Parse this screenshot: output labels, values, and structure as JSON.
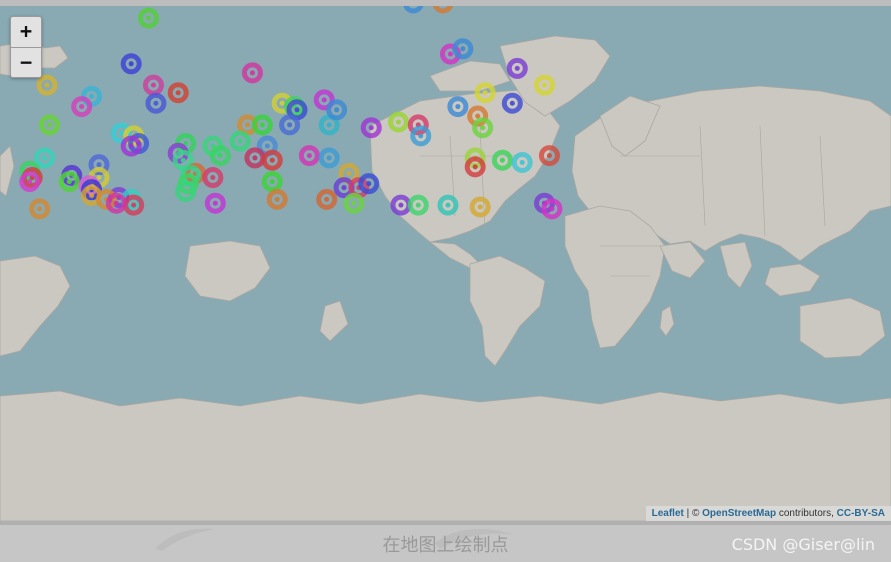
{
  "zoom": {
    "in_label": "+",
    "out_label": "−"
  },
  "attribution": {
    "leaflet": "Leaflet",
    "sep": " | © ",
    "osm": "OpenStreetMap",
    "contributors": " contributors, ",
    "license": "CC-BY-SA"
  },
  "caption": "在地图上绘制点",
  "watermark": "CSDN @Giser@lin",
  "colors": {
    "ocean": "#89a9b3",
    "land": "#cbc8c2",
    "border": "#a9a6a0"
  },
  "markers": [
    {
      "lon": -130,
      "lat": 75,
      "color": "#53d034"
    },
    {
      "lon": -137,
      "lat": 67,
      "color": "#3b3fd7"
    },
    {
      "lon": -128,
      "lat": 62,
      "color": "#d03b9c"
    },
    {
      "lon": -127,
      "lat": 57,
      "color": "#4a55d6"
    },
    {
      "lon": -118,
      "lat": 60,
      "color": "#d4402f"
    },
    {
      "lon": -153,
      "lat": 59,
      "color": "#37b4d4"
    },
    {
      "lon": -171,
      "lat": 62,
      "color": "#d4b12f"
    },
    {
      "lon": -157,
      "lat": 56,
      "color": "#d63dbb"
    },
    {
      "lon": -170,
      "lat": 50,
      "color": "#66d42f"
    },
    {
      "lon": -141,
      "lat": 47,
      "color": "#31d0d4"
    },
    {
      "lon": -136,
      "lat": 46,
      "color": "#d4d02f"
    },
    {
      "lon": -134,
      "lat": 43,
      "color": "#3b58d4"
    },
    {
      "lon": -137,
      "lat": 42,
      "color": "#a032d4"
    },
    {
      "lon": -172,
      "lat": 37,
      "color": "#32d4b9"
    },
    {
      "lon": -150,
      "lat": 34,
      "color": "#4f67d6"
    },
    {
      "lon": -161,
      "lat": 29,
      "color": "#5532d4"
    },
    {
      "lon": -162,
      "lat": 26,
      "color": "#4fd432"
    },
    {
      "lon": -150,
      "lat": 28,
      "color": "#d4cc2f"
    },
    {
      "lon": -154,
      "lat": 24,
      "color": "#d45cd4"
    },
    {
      "lon": -153,
      "lat": 22,
      "color": "#3b2fd4"
    },
    {
      "lon": -153,
      "lat": 19,
      "color": "#d4a82f"
    },
    {
      "lon": -142,
      "lat": 18,
      "color": "#7d3bd4"
    },
    {
      "lon": -147,
      "lat": 17,
      "color": "#d48a2f"
    },
    {
      "lon": -137,
      "lat": 17,
      "color": "#31d0c0"
    },
    {
      "lon": -136,
      "lat": 14,
      "color": "#d43b5a"
    },
    {
      "lon": -143,
      "lat": 15,
      "color": "#d432a4"
    },
    {
      "lon": -178,
      "lat": 31,
      "color": "#37d45e"
    },
    {
      "lon": -177,
      "lat": 28,
      "color": "#d43b3b"
    },
    {
      "lon": -178,
      "lat": 26,
      "color": "#d43bd0"
    },
    {
      "lon": -174,
      "lat": 12,
      "color": "#d4882f"
    },
    {
      "lon": -115,
      "lat": 43,
      "color": "#31d45a"
    },
    {
      "lon": -118,
      "lat": 39,
      "color": "#8b3bd4"
    },
    {
      "lon": -116,
      "lat": 36,
      "color": "#3bd48a"
    },
    {
      "lon": -104,
      "lat": 42,
      "color": "#3bd47a"
    },
    {
      "lon": -101,
      "lat": 38,
      "color": "#37d460"
    },
    {
      "lon": -111,
      "lat": 30,
      "color": "#d46a2f"
    },
    {
      "lon": -113,
      "lat": 29,
      "color": "#2fd48a"
    },
    {
      "lon": -114,
      "lat": 25,
      "color": "#3bd460"
    },
    {
      "lon": -104,
      "lat": 28,
      "color": "#d43b6a"
    },
    {
      "lon": -115,
      "lat": 21,
      "color": "#37d47a"
    },
    {
      "lon": -103,
      "lat": 15,
      "color": "#c432d4"
    },
    {
      "lon": -88,
      "lat": 65,
      "color": "#d432a0"
    },
    {
      "lon": -90,
      "lat": 50,
      "color": "#d4892f"
    },
    {
      "lon": -84,
      "lat": 50,
      "color": "#37d43b"
    },
    {
      "lon": -93,
      "lat": 44,
      "color": "#37d47a"
    },
    {
      "lon": -82,
      "lat": 42,
      "color": "#4a8ad4"
    },
    {
      "lon": -87,
      "lat": 37,
      "color": "#c4325e"
    },
    {
      "lon": -80,
      "lat": 36,
      "color": "#d43b3b"
    },
    {
      "lon": -80,
      "lat": 26,
      "color": "#3bd432"
    },
    {
      "lon": -78,
      "lat": 17,
      "color": "#d4782f"
    },
    {
      "lon": -76,
      "lat": 57,
      "color": "#d4d02f"
    },
    {
      "lon": -71,
      "lat": 56,
      "color": "#3bd45a"
    },
    {
      "lon": -70,
      "lat": 55,
      "color": "#3b4ad4"
    },
    {
      "lon": -73,
      "lat": 50,
      "color": "#4a6ad4"
    },
    {
      "lon": -59,
      "lat": 58,
      "color": "#c432d4"
    },
    {
      "lon": -57,
      "lat": 50,
      "color": "#2fb4c8"
    },
    {
      "lon": -54,
      "lat": 55,
      "color": "#3b8ad4"
    },
    {
      "lon": -65,
      "lat": 38,
      "color": "#d432b4"
    },
    {
      "lon": -57,
      "lat": 37,
      "color": "#3b9cd4"
    },
    {
      "lon": -49,
      "lat": 30,
      "color": "#d4a82f"
    },
    {
      "lon": -51,
      "lat": 23,
      "color": "#6a3bd4"
    },
    {
      "lon": -45,
      "lat": 23,
      "color": "#d43b6a"
    },
    {
      "lon": -41,
      "lat": 25,
      "color": "#3b4ad4"
    },
    {
      "lon": -58,
      "lat": 17,
      "color": "#d4652f"
    },
    {
      "lon": -47,
      "lat": 15,
      "color": "#6ad43b"
    },
    {
      "lon": -78,
      "lat": 78,
      "color": "#d432c4"
    },
    {
      "lon": -51,
      "lat": 80,
      "color": "#d4c42f"
    },
    {
      "lon": -53,
      "lat": 78,
      "color": "#3b7ad4"
    },
    {
      "lon": -28,
      "lat": 81,
      "color": "#d4442f"
    },
    {
      "lon": -23,
      "lat": 77,
      "color": "#3b8ad4"
    },
    {
      "lon": 3,
      "lat": 83,
      "color": "#7a3bd4"
    },
    {
      "lon": -5,
      "lat": 79,
      "color": "#2fc4c4"
    },
    {
      "lon": -11,
      "lat": 77,
      "color": "#d4782f"
    },
    {
      "lon": 17,
      "lat": 80,
      "color": "#d43b3b"
    },
    {
      "lon": 41,
      "lat": 79,
      "color": "#6ad43b"
    },
    {
      "lon": -40,
      "lat": 49,
      "color": "#a032d4"
    },
    {
      "lon": -29,
      "lat": 51,
      "color": "#98d432"
    },
    {
      "lon": -21,
      "lat": 50,
      "color": "#d43b6a"
    },
    {
      "lon": -20,
      "lat": 46,
      "color": "#3b9cd4"
    },
    {
      "lon": -8,
      "lat": 69,
      "color": "#d432c4"
    },
    {
      "lon": -3,
      "lat": 70,
      "color": "#3b8ad4"
    },
    {
      "lon": -5,
      "lat": 56,
      "color": "#3b8ad4"
    },
    {
      "lon": 3,
      "lat": 53,
      "color": "#d4782f"
    },
    {
      "lon": 6,
      "lat": 60,
      "color": "#d4d42f"
    },
    {
      "lon": 5,
      "lat": 49,
      "color": "#6ad43b"
    },
    {
      "lon": 19,
      "lat": 66,
      "color": "#7a3bd4"
    },
    {
      "lon": 17,
      "lat": 57,
      "color": "#3b4ad4"
    },
    {
      "lon": 30,
      "lat": 62,
      "color": "#d4d42f"
    },
    {
      "lon": 2,
      "lat": 37,
      "color": "#98d43b"
    },
    {
      "lon": 2,
      "lat": 33,
      "color": "#d43b3b"
    },
    {
      "lon": 13,
      "lat": 36,
      "color": "#3bd45a"
    },
    {
      "lon": 21,
      "lat": 35,
      "color": "#3bc4d4"
    },
    {
      "lon": 32,
      "lat": 38,
      "color": "#d44a3b"
    },
    {
      "lon": -28,
      "lat": 14,
      "color": "#7a3bd4"
    },
    {
      "lon": -21,
      "lat": 14,
      "color": "#3bd46a"
    },
    {
      "lon": -9,
      "lat": 14,
      "color": "#2fc4b4"
    },
    {
      "lon": 4,
      "lat": 13,
      "color": "#d4a82f"
    },
    {
      "lon": 30,
      "lat": 15,
      "color": "#7a3bd4"
    },
    {
      "lon": 33,
      "lat": 12,
      "color": "#d432c4"
    }
  ]
}
